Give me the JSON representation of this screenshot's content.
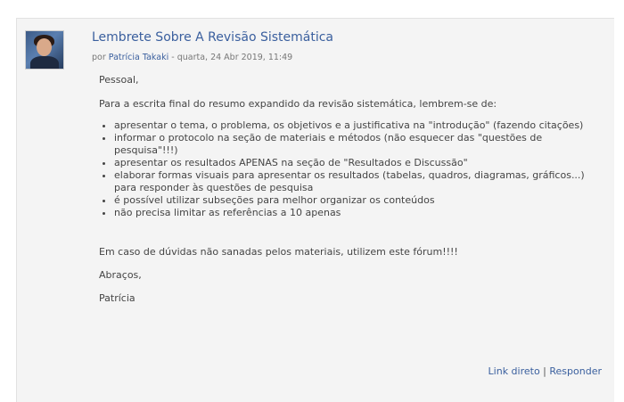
{
  "post": {
    "subject": "Lembrete Sobre A Revisão Sistemática",
    "by_prefix": "por",
    "author": "Patrícia Takaki",
    "date": " - quarta, 24 Abr 2019, 11:49",
    "greeting": "Pessoal,",
    "intro": "Para a escrita final do resumo expandido da revisão sistemática, lembrem-se de:",
    "items": [
      "apresentar o tema, o problema, os objetivos e a justificativa na \"introdução\" (fazendo citações)",
      "informar o protocolo na seção de materiais e métodos (não esquecer das \"questões de pesquisa\"!!!)",
      "apresentar os resultados APENAS na seção de \"Resultados e Discussão\"",
      "elaborar formas visuais para apresentar os resultados (tabelas, quadros, diagramas, gráficos...) para responder às questões de pesquisa",
      "é possível utilizar subseções para melhor organizar os conteúdos",
      "não precisa limitar as referências a 10 apenas"
    ],
    "doubts": "Em caso de dúvidas não sanadas pelos materiais, utilizem este fórum!!!!",
    "farewell": "Abraços,",
    "signature": "Patrícia"
  },
  "footer": {
    "link_direct": "Link direto",
    "separator": " | ",
    "reply": "Responder"
  },
  "icons": {
    "avatar": "user-avatar"
  },
  "colors": {
    "link": "#3a5f9e",
    "background": "#f4f4f4"
  }
}
